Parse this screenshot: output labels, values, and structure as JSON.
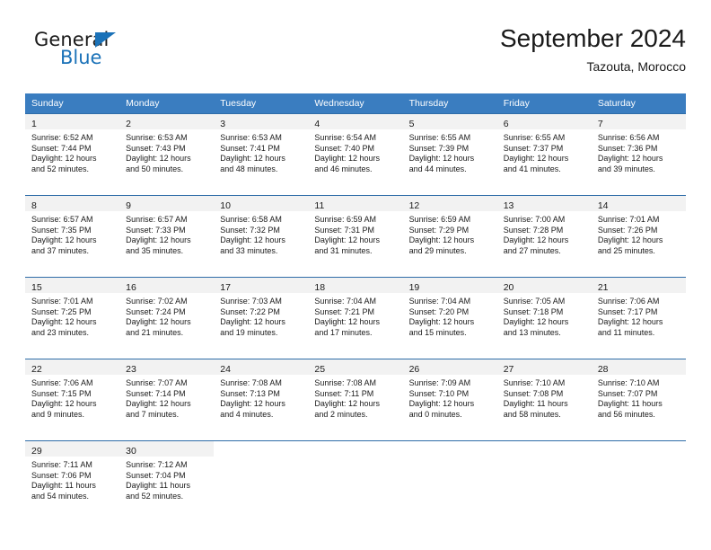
{
  "brand": {
    "name_part1": "General",
    "name_part2": "Blue",
    "logo_icon": "triangle-icon"
  },
  "header": {
    "title": "September 2024",
    "subtitle": "Tazouta, Morocco"
  },
  "colors": {
    "header_blue": "#3a7dc0",
    "grid_line": "#2f6da8",
    "daynum_band": "#f2f2f2",
    "brand_blue": "#1b72b8"
  },
  "weekdays": [
    "Sunday",
    "Monday",
    "Tuesday",
    "Wednesday",
    "Thursday",
    "Friday",
    "Saturday"
  ],
  "weeks": [
    [
      {
        "day": "1",
        "sunrise": "Sunrise: 6:52 AM",
        "sunset": "Sunset: 7:44 PM",
        "daylight_line1": "Daylight: 12 hours",
        "daylight_line2": "and 52 minutes."
      },
      {
        "day": "2",
        "sunrise": "Sunrise: 6:53 AM",
        "sunset": "Sunset: 7:43 PM",
        "daylight_line1": "Daylight: 12 hours",
        "daylight_line2": "and 50 minutes."
      },
      {
        "day": "3",
        "sunrise": "Sunrise: 6:53 AM",
        "sunset": "Sunset: 7:41 PM",
        "daylight_line1": "Daylight: 12 hours",
        "daylight_line2": "and 48 minutes."
      },
      {
        "day": "4",
        "sunrise": "Sunrise: 6:54 AM",
        "sunset": "Sunset: 7:40 PM",
        "daylight_line1": "Daylight: 12 hours",
        "daylight_line2": "and 46 minutes."
      },
      {
        "day": "5",
        "sunrise": "Sunrise: 6:55 AM",
        "sunset": "Sunset: 7:39 PM",
        "daylight_line1": "Daylight: 12 hours",
        "daylight_line2": "and 44 minutes."
      },
      {
        "day": "6",
        "sunrise": "Sunrise: 6:55 AM",
        "sunset": "Sunset: 7:37 PM",
        "daylight_line1": "Daylight: 12 hours",
        "daylight_line2": "and 41 minutes."
      },
      {
        "day": "7",
        "sunrise": "Sunrise: 6:56 AM",
        "sunset": "Sunset: 7:36 PM",
        "daylight_line1": "Daylight: 12 hours",
        "daylight_line2": "and 39 minutes."
      }
    ],
    [
      {
        "day": "8",
        "sunrise": "Sunrise: 6:57 AM",
        "sunset": "Sunset: 7:35 PM",
        "daylight_line1": "Daylight: 12 hours",
        "daylight_line2": "and 37 minutes."
      },
      {
        "day": "9",
        "sunrise": "Sunrise: 6:57 AM",
        "sunset": "Sunset: 7:33 PM",
        "daylight_line1": "Daylight: 12 hours",
        "daylight_line2": "and 35 minutes."
      },
      {
        "day": "10",
        "sunrise": "Sunrise: 6:58 AM",
        "sunset": "Sunset: 7:32 PM",
        "daylight_line1": "Daylight: 12 hours",
        "daylight_line2": "and 33 minutes."
      },
      {
        "day": "11",
        "sunrise": "Sunrise: 6:59 AM",
        "sunset": "Sunset: 7:31 PM",
        "daylight_line1": "Daylight: 12 hours",
        "daylight_line2": "and 31 minutes."
      },
      {
        "day": "12",
        "sunrise": "Sunrise: 6:59 AM",
        "sunset": "Sunset: 7:29 PM",
        "daylight_line1": "Daylight: 12 hours",
        "daylight_line2": "and 29 minutes."
      },
      {
        "day": "13",
        "sunrise": "Sunrise: 7:00 AM",
        "sunset": "Sunset: 7:28 PM",
        "daylight_line1": "Daylight: 12 hours",
        "daylight_line2": "and 27 minutes."
      },
      {
        "day": "14",
        "sunrise": "Sunrise: 7:01 AM",
        "sunset": "Sunset: 7:26 PM",
        "daylight_line1": "Daylight: 12 hours",
        "daylight_line2": "and 25 minutes."
      }
    ],
    [
      {
        "day": "15",
        "sunrise": "Sunrise: 7:01 AM",
        "sunset": "Sunset: 7:25 PM",
        "daylight_line1": "Daylight: 12 hours",
        "daylight_line2": "and 23 minutes."
      },
      {
        "day": "16",
        "sunrise": "Sunrise: 7:02 AM",
        "sunset": "Sunset: 7:24 PM",
        "daylight_line1": "Daylight: 12 hours",
        "daylight_line2": "and 21 minutes."
      },
      {
        "day": "17",
        "sunrise": "Sunrise: 7:03 AM",
        "sunset": "Sunset: 7:22 PM",
        "daylight_line1": "Daylight: 12 hours",
        "daylight_line2": "and 19 minutes."
      },
      {
        "day": "18",
        "sunrise": "Sunrise: 7:04 AM",
        "sunset": "Sunset: 7:21 PM",
        "daylight_line1": "Daylight: 12 hours",
        "daylight_line2": "and 17 minutes."
      },
      {
        "day": "19",
        "sunrise": "Sunrise: 7:04 AM",
        "sunset": "Sunset: 7:20 PM",
        "daylight_line1": "Daylight: 12 hours",
        "daylight_line2": "and 15 minutes."
      },
      {
        "day": "20",
        "sunrise": "Sunrise: 7:05 AM",
        "sunset": "Sunset: 7:18 PM",
        "daylight_line1": "Daylight: 12 hours",
        "daylight_line2": "and 13 minutes."
      },
      {
        "day": "21",
        "sunrise": "Sunrise: 7:06 AM",
        "sunset": "Sunset: 7:17 PM",
        "daylight_line1": "Daylight: 12 hours",
        "daylight_line2": "and 11 minutes."
      }
    ],
    [
      {
        "day": "22",
        "sunrise": "Sunrise: 7:06 AM",
        "sunset": "Sunset: 7:15 PM",
        "daylight_line1": "Daylight: 12 hours",
        "daylight_line2": "and 9 minutes."
      },
      {
        "day": "23",
        "sunrise": "Sunrise: 7:07 AM",
        "sunset": "Sunset: 7:14 PM",
        "daylight_line1": "Daylight: 12 hours",
        "daylight_line2": "and 7 minutes."
      },
      {
        "day": "24",
        "sunrise": "Sunrise: 7:08 AM",
        "sunset": "Sunset: 7:13 PM",
        "daylight_line1": "Daylight: 12 hours",
        "daylight_line2": "and 4 minutes."
      },
      {
        "day": "25",
        "sunrise": "Sunrise: 7:08 AM",
        "sunset": "Sunset: 7:11 PM",
        "daylight_line1": "Daylight: 12 hours",
        "daylight_line2": "and 2 minutes."
      },
      {
        "day": "26",
        "sunrise": "Sunrise: 7:09 AM",
        "sunset": "Sunset: 7:10 PM",
        "daylight_line1": "Daylight: 12 hours",
        "daylight_line2": "and 0 minutes."
      },
      {
        "day": "27",
        "sunrise": "Sunrise: 7:10 AM",
        "sunset": "Sunset: 7:08 PM",
        "daylight_line1": "Daylight: 11 hours",
        "daylight_line2": "and 58 minutes."
      },
      {
        "day": "28",
        "sunrise": "Sunrise: 7:10 AM",
        "sunset": "Sunset: 7:07 PM",
        "daylight_line1": "Daylight: 11 hours",
        "daylight_line2": "and 56 minutes."
      }
    ],
    [
      {
        "day": "29",
        "sunrise": "Sunrise: 7:11 AM",
        "sunset": "Sunset: 7:06 PM",
        "daylight_line1": "Daylight: 11 hours",
        "daylight_line2": "and 54 minutes."
      },
      {
        "day": "30",
        "sunrise": "Sunrise: 7:12 AM",
        "sunset": "Sunset: 7:04 PM",
        "daylight_line1": "Daylight: 11 hours",
        "daylight_line2": "and 52 minutes."
      },
      {
        "day": "",
        "sunrise": "",
        "sunset": "",
        "daylight_line1": "",
        "daylight_line2": ""
      },
      {
        "day": "",
        "sunrise": "",
        "sunset": "",
        "daylight_line1": "",
        "daylight_line2": ""
      },
      {
        "day": "",
        "sunrise": "",
        "sunset": "",
        "daylight_line1": "",
        "daylight_line2": ""
      },
      {
        "day": "",
        "sunrise": "",
        "sunset": "",
        "daylight_line1": "",
        "daylight_line2": ""
      },
      {
        "day": "",
        "sunrise": "",
        "sunset": "",
        "daylight_line1": "",
        "daylight_line2": ""
      }
    ]
  ]
}
